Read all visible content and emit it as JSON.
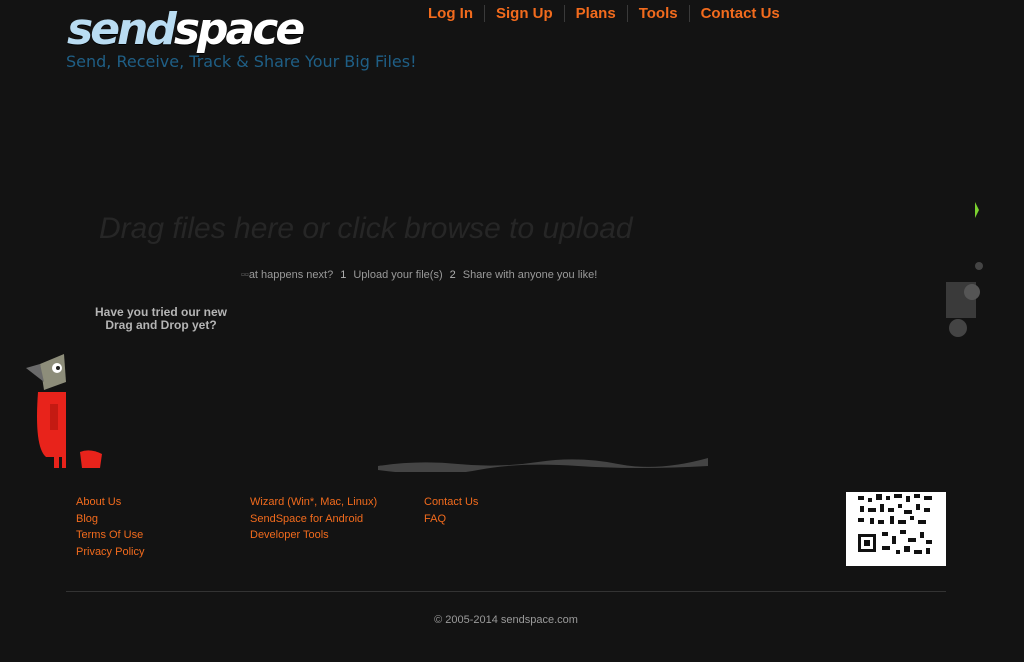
{
  "header": {
    "logo_send": "send",
    "logo_space": "space",
    "tagline": "Send, Receive, Track & Share Your Big Files!"
  },
  "nav": [
    {
      "label": "Log In"
    },
    {
      "label": "Sign Up"
    },
    {
      "label": "Plans"
    },
    {
      "label": "Tools"
    },
    {
      "label": "Contact Us"
    }
  ],
  "upload": {
    "dropzone_text": "Drag files here or click browse to upload",
    "steps_intro": "at happens next?",
    "step1_num": "1",
    "step1_text": "Upload your file(s)",
    "step2_num": "2",
    "step2_text": "Share with anyone you like!"
  },
  "promo": {
    "line1": "Have you tried our new",
    "line2": "Drag and Drop yet?"
  },
  "footer": {
    "col1": [
      "About Us",
      "Blog",
      "Terms Of Use",
      "Privacy Policy"
    ],
    "col2": [
      "Wizard (Win*, Mac, Linux)",
      "SendSpace for Android",
      "Developer Tools"
    ],
    "col3": [
      "Contact Us",
      "FAQ"
    ],
    "copyright": "© 2005-2014 sendspace.com"
  },
  "colors": {
    "background": "#131313",
    "link": "#f26b1d",
    "tagline": "#1f5f86"
  }
}
